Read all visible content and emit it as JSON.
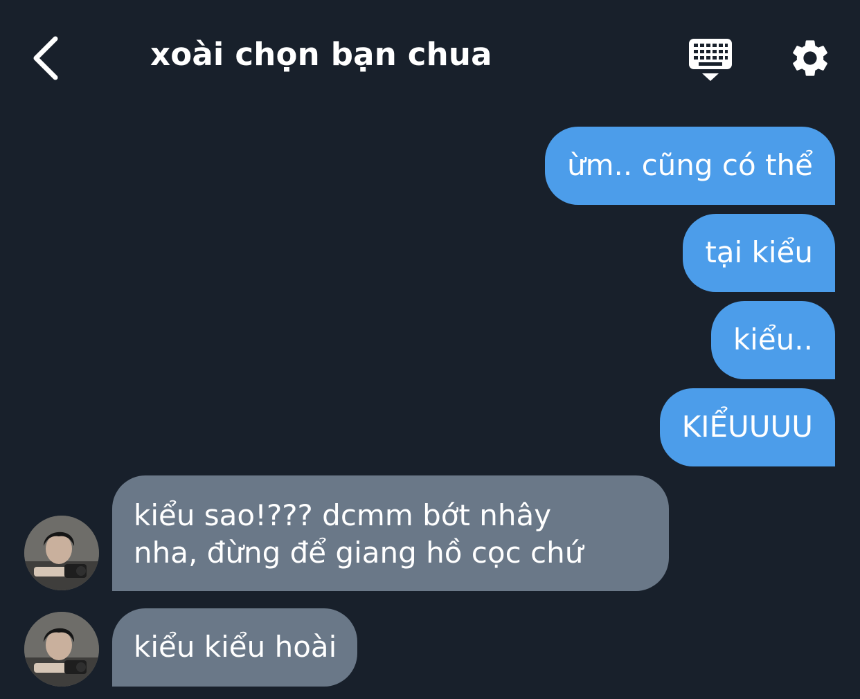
{
  "header": {
    "title": "xoài chọn bạn chua",
    "back_icon": "chevron-left-icon",
    "keyboard_icon": "keyboard-hide-icon",
    "settings_icon": "gear-icon"
  },
  "colors": {
    "background": "#18202b",
    "outgoing_bubble": "#4c9dea",
    "incoming_bubble": "#6a7888",
    "text": "#ffffff"
  },
  "messages": [
    {
      "direction": "outgoing",
      "text": "ừm.. cũng có thể"
    },
    {
      "direction": "outgoing",
      "text": "tại kiểu"
    },
    {
      "direction": "outgoing",
      "text": "kiểu.."
    },
    {
      "direction": "outgoing",
      "text": "KIỂUUUU"
    },
    {
      "direction": "incoming",
      "lines": [
        "kiểu sao!??? dcmm bớt nhây",
        "nha, đừng để giang hồ cọc chứ"
      ]
    },
    {
      "direction": "incoming",
      "text": "kiểu kiểu hoài"
    }
  ]
}
